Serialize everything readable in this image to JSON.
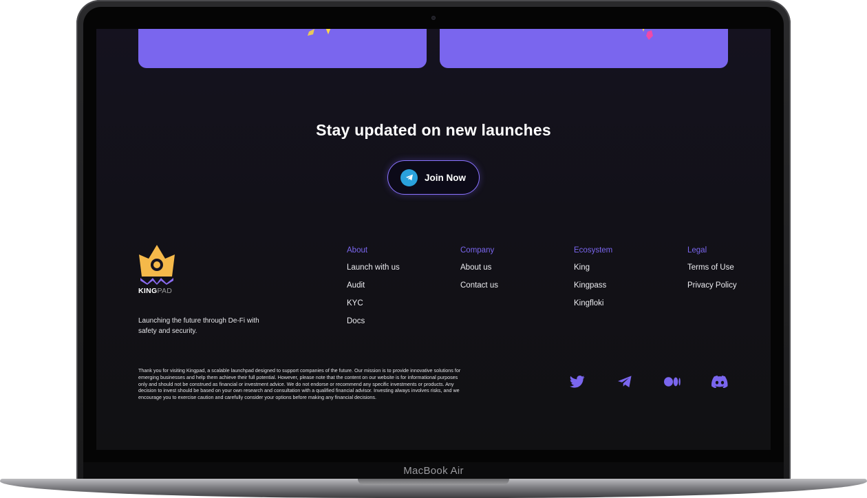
{
  "device": {
    "brand_label": "MacBook Air"
  },
  "newsletter": {
    "heading": "Stay updated on new launches",
    "join_button": "Join Now"
  },
  "brand": {
    "logo_text_main": "KING",
    "logo_text_suffix": "PAD",
    "tagline": "Launching the future through De-Fi with safety and security."
  },
  "footer": {
    "columns": [
      {
        "title": "About",
        "links": [
          "Launch with us",
          "Audit",
          "KYC",
          "Docs"
        ]
      },
      {
        "title": "Company",
        "links": [
          "About us",
          "Contact us"
        ]
      },
      {
        "title": "Ecosystem",
        "links": [
          "King",
          "Kingpass",
          "Kingfloki"
        ]
      },
      {
        "title": "Legal",
        "links": [
          "Terms of Use",
          "Privacy Policy"
        ]
      }
    ],
    "disclaimer": "Thank you for visiting Kingpad, a scalable launchpad designed to support companies of the future. Our mission is to provide innovative solutions for emerging businesses and help them achieve their full potential. However, please note that the content on our website is for informational purposes only and should not be construed as financial or investment advice. We do not endorse or recommend any specific investments or products. Any decision to invest should be based on your own research and consultation with a qualified financial advisor. Investing always involves risks, and we encourage you to exercise caution and carefully consider your options before making any financial decisions."
  },
  "social_icons": [
    "twitter-icon",
    "telegram-icon",
    "medium-icon",
    "discord-icon"
  ],
  "colors": {
    "accent": "#7a66ee",
    "card": "#7a66ee",
    "telegram": "#2aa1dc",
    "logo_gold": "#f5b94a"
  }
}
